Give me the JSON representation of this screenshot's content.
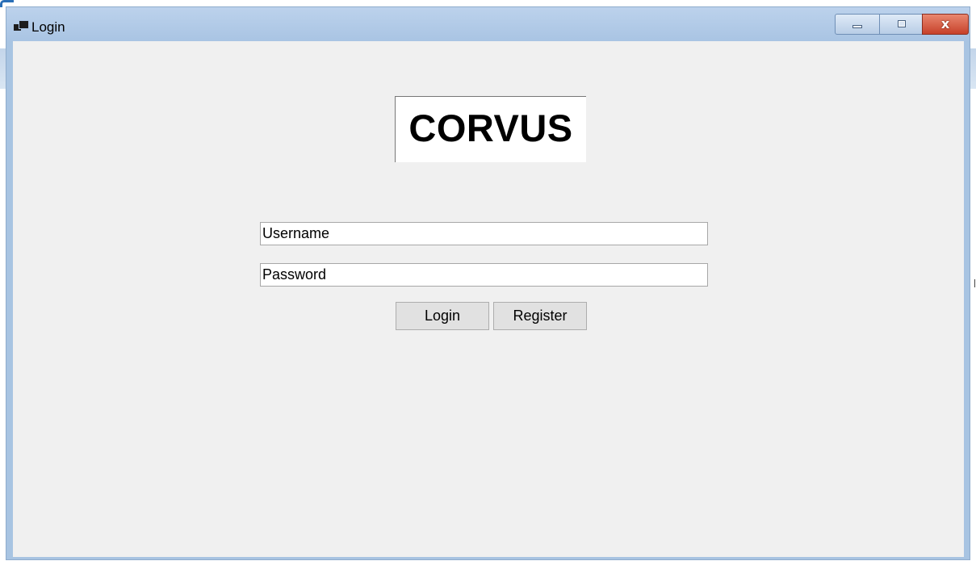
{
  "window": {
    "title": "Login",
    "controls": {
      "minimize_icon": "minimize-icon",
      "maximize_icon": "maximize-icon",
      "close_glyph": "x"
    }
  },
  "logo": {
    "text": "CORVUS"
  },
  "form": {
    "username": {
      "value": "Username"
    },
    "password": {
      "value": "Password"
    },
    "login_label": "Login",
    "register_label": "Register"
  },
  "colors": {
    "titlebar": "#a9c4e3",
    "client_background": "#f0f0f0",
    "close_button": "#c7412a",
    "button_face": "#e1e1e1"
  }
}
